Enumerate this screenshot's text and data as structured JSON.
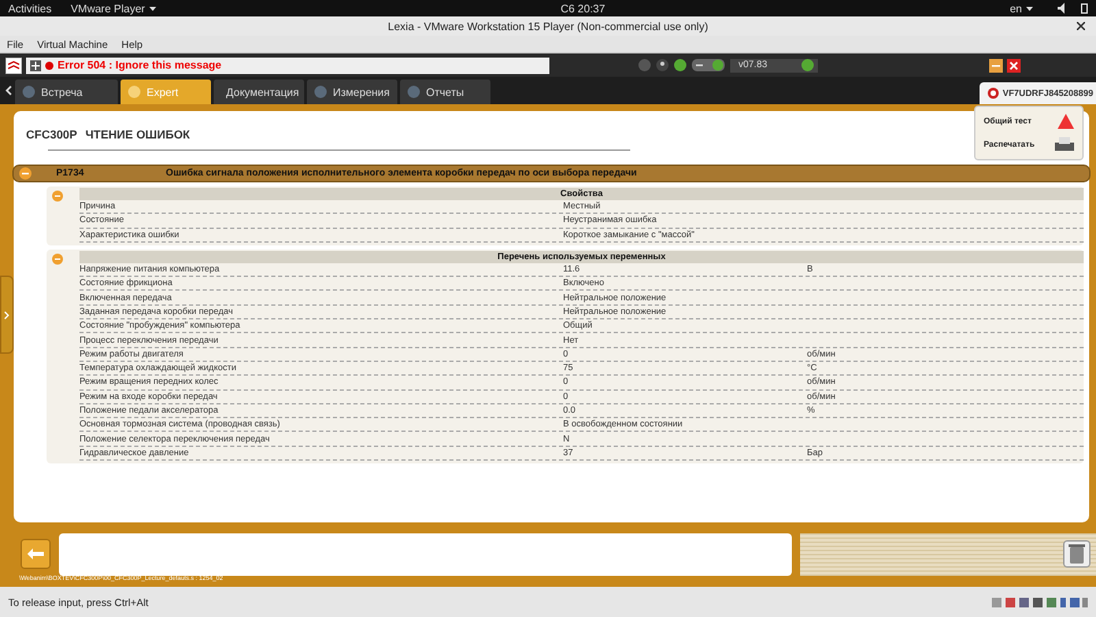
{
  "top_bar": {
    "activities": "Activities",
    "app_menu": "VMware Player",
    "clock": "С6 20:37",
    "language": "en"
  },
  "window": {
    "title": "Lexia - VMware Workstation 15 Player (Non-commercial use only)"
  },
  "menu": [
    "File",
    "Virtual Machine",
    "Help"
  ],
  "toolbar": {
    "error_message": "Error 504 : Ignore this message",
    "version": "v07.83"
  },
  "tabs": [
    {
      "label": "Встреча",
      "selected": false
    },
    {
      "label": "Expert",
      "selected": true
    },
    {
      "label": "Документация",
      "selected": false
    },
    {
      "label": "Измерения",
      "selected": false
    },
    {
      "label": "Отчеты",
      "selected": false
    }
  ],
  "vehicle_id": "VF7UDRFJ845208899",
  "side_buttons": [
    "Общий тест",
    "Распечатать"
  ],
  "page": {
    "ecu": "CFC300P",
    "title": "ЧТЕНИЕ ОШИБОК"
  },
  "fault": {
    "code": "P1734",
    "description": "Ошибка сигнала положения исполнительного элемента коробки передач по оси выбора передачи",
    "expanded": true
  },
  "properties": {
    "title": "Свойства",
    "expanded": true,
    "rows": [
      {
        "name": "Причина",
        "value": "Местный"
      },
      {
        "name": "Состояние",
        "value": "Неустранимая ошибка"
      },
      {
        "name": "Характеристика ошибки",
        "value": "Короткое замыкание с \"массой\""
      }
    ]
  },
  "variables": {
    "title": "Перечень используемых переменных",
    "expanded": true,
    "rows": [
      {
        "name": "Напряжение питания компьютера",
        "value": "11.6",
        "unit": "В"
      },
      {
        "name": "Состояние фрикциона",
        "value": "Включено"
      },
      {
        "name": "Включенная передача",
        "value": "Нейтральное положение"
      },
      {
        "name": "Заданная передача коробки передач",
        "value": "Нейтральное положение"
      },
      {
        "name": "Состояние \"пробуждения\" компьютера",
        "value": "Общий"
      },
      {
        "name": "Процесс переключения передачи",
        "value": "Нет"
      },
      {
        "name": "Режим работы двигателя",
        "value": "0",
        "unit": "об/мин"
      },
      {
        "name": "Температура охлаждающей жидкости",
        "value": "75",
        "unit": "°C"
      },
      {
        "name": "Режим вращения передних колес",
        "value": "0",
        "unit": "об/мин"
      },
      {
        "name": "Режим на входе коробки передач",
        "value": "0",
        "unit": "об/мин"
      },
      {
        "name": "Положение педали акселератора",
        "value": "0.0",
        "unit": "%"
      },
      {
        "name": "Основная тормозная система (проводная связь)",
        "value": "В освобожденном состоянии"
      },
      {
        "name": "Положение селектора переключения передач",
        "value": "N"
      },
      {
        "name": "Гидравлическое давление",
        "value": "37",
        "unit": "Бар"
      }
    ]
  },
  "footer_path": "\\Webanim\\BOXTEV\\CFC300P\\00_CFC300P_Lecture_defauts.s : 1254_02",
  "status_bar": "To release input, press Ctrl+Alt"
}
